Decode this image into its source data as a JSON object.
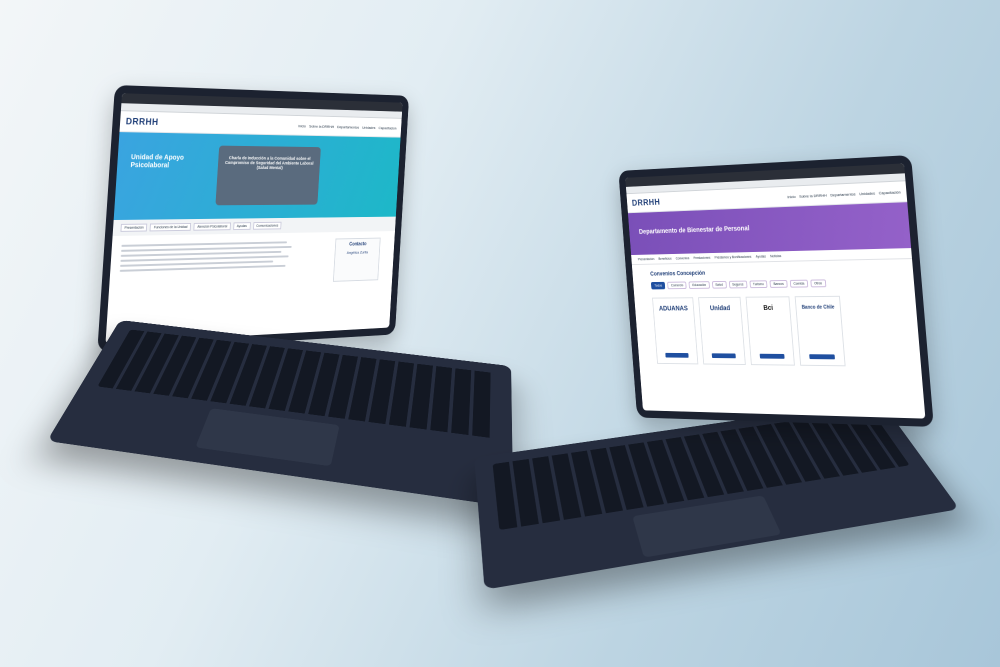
{
  "laptop_left": {
    "logo": "DRRHH",
    "nav": [
      "Inicio",
      "Sobre la DRRHH",
      "Departamentos",
      "Unidades",
      "Capacitación"
    ],
    "hero_title": "Unidad de Apoyo Psicolaboral",
    "hero_card": "Charla de Inducción a la Comunidad sobre el Compromiso de Seguridad del Ambiente Laboral (Salud Mental)",
    "tabs": [
      "Presentación",
      "Funciones de la Unidad",
      "Atención Psicolaboral",
      "Ayudas",
      "Comunicaciones"
    ],
    "contact_title": "Contacto",
    "contact_name": "Angélica Zurita"
  },
  "laptop_right": {
    "logo": "DRRHH",
    "nav": [
      "Inicio",
      "Sobre la DRRHH",
      "Departamentos",
      "Unidades",
      "Capacitación"
    ],
    "hero_title": "Departamento de Bienestar de Personal",
    "subnav": [
      "Presentación",
      "Beneficios",
      "Convenios",
      "Prestaciones",
      "Préstamos y Bonificaciones",
      "Ayudas",
      "Noticias"
    ],
    "section_title": "Convenios Concepción",
    "chips": [
      "Todos",
      "Comercio",
      "Educación",
      "Salud",
      "Seguros",
      "Turismo",
      "Bancos",
      "Comida",
      "Otros"
    ],
    "cards": [
      {
        "logo": "ADUANAS",
        "color": "#1f3e77"
      },
      {
        "logo": "Unidad",
        "color": "#1f3e77"
      },
      {
        "logo": "Bci",
        "color": "#111111"
      },
      {
        "logo": "Banco de Chile",
        "color": "#1f3e77"
      }
    ]
  }
}
